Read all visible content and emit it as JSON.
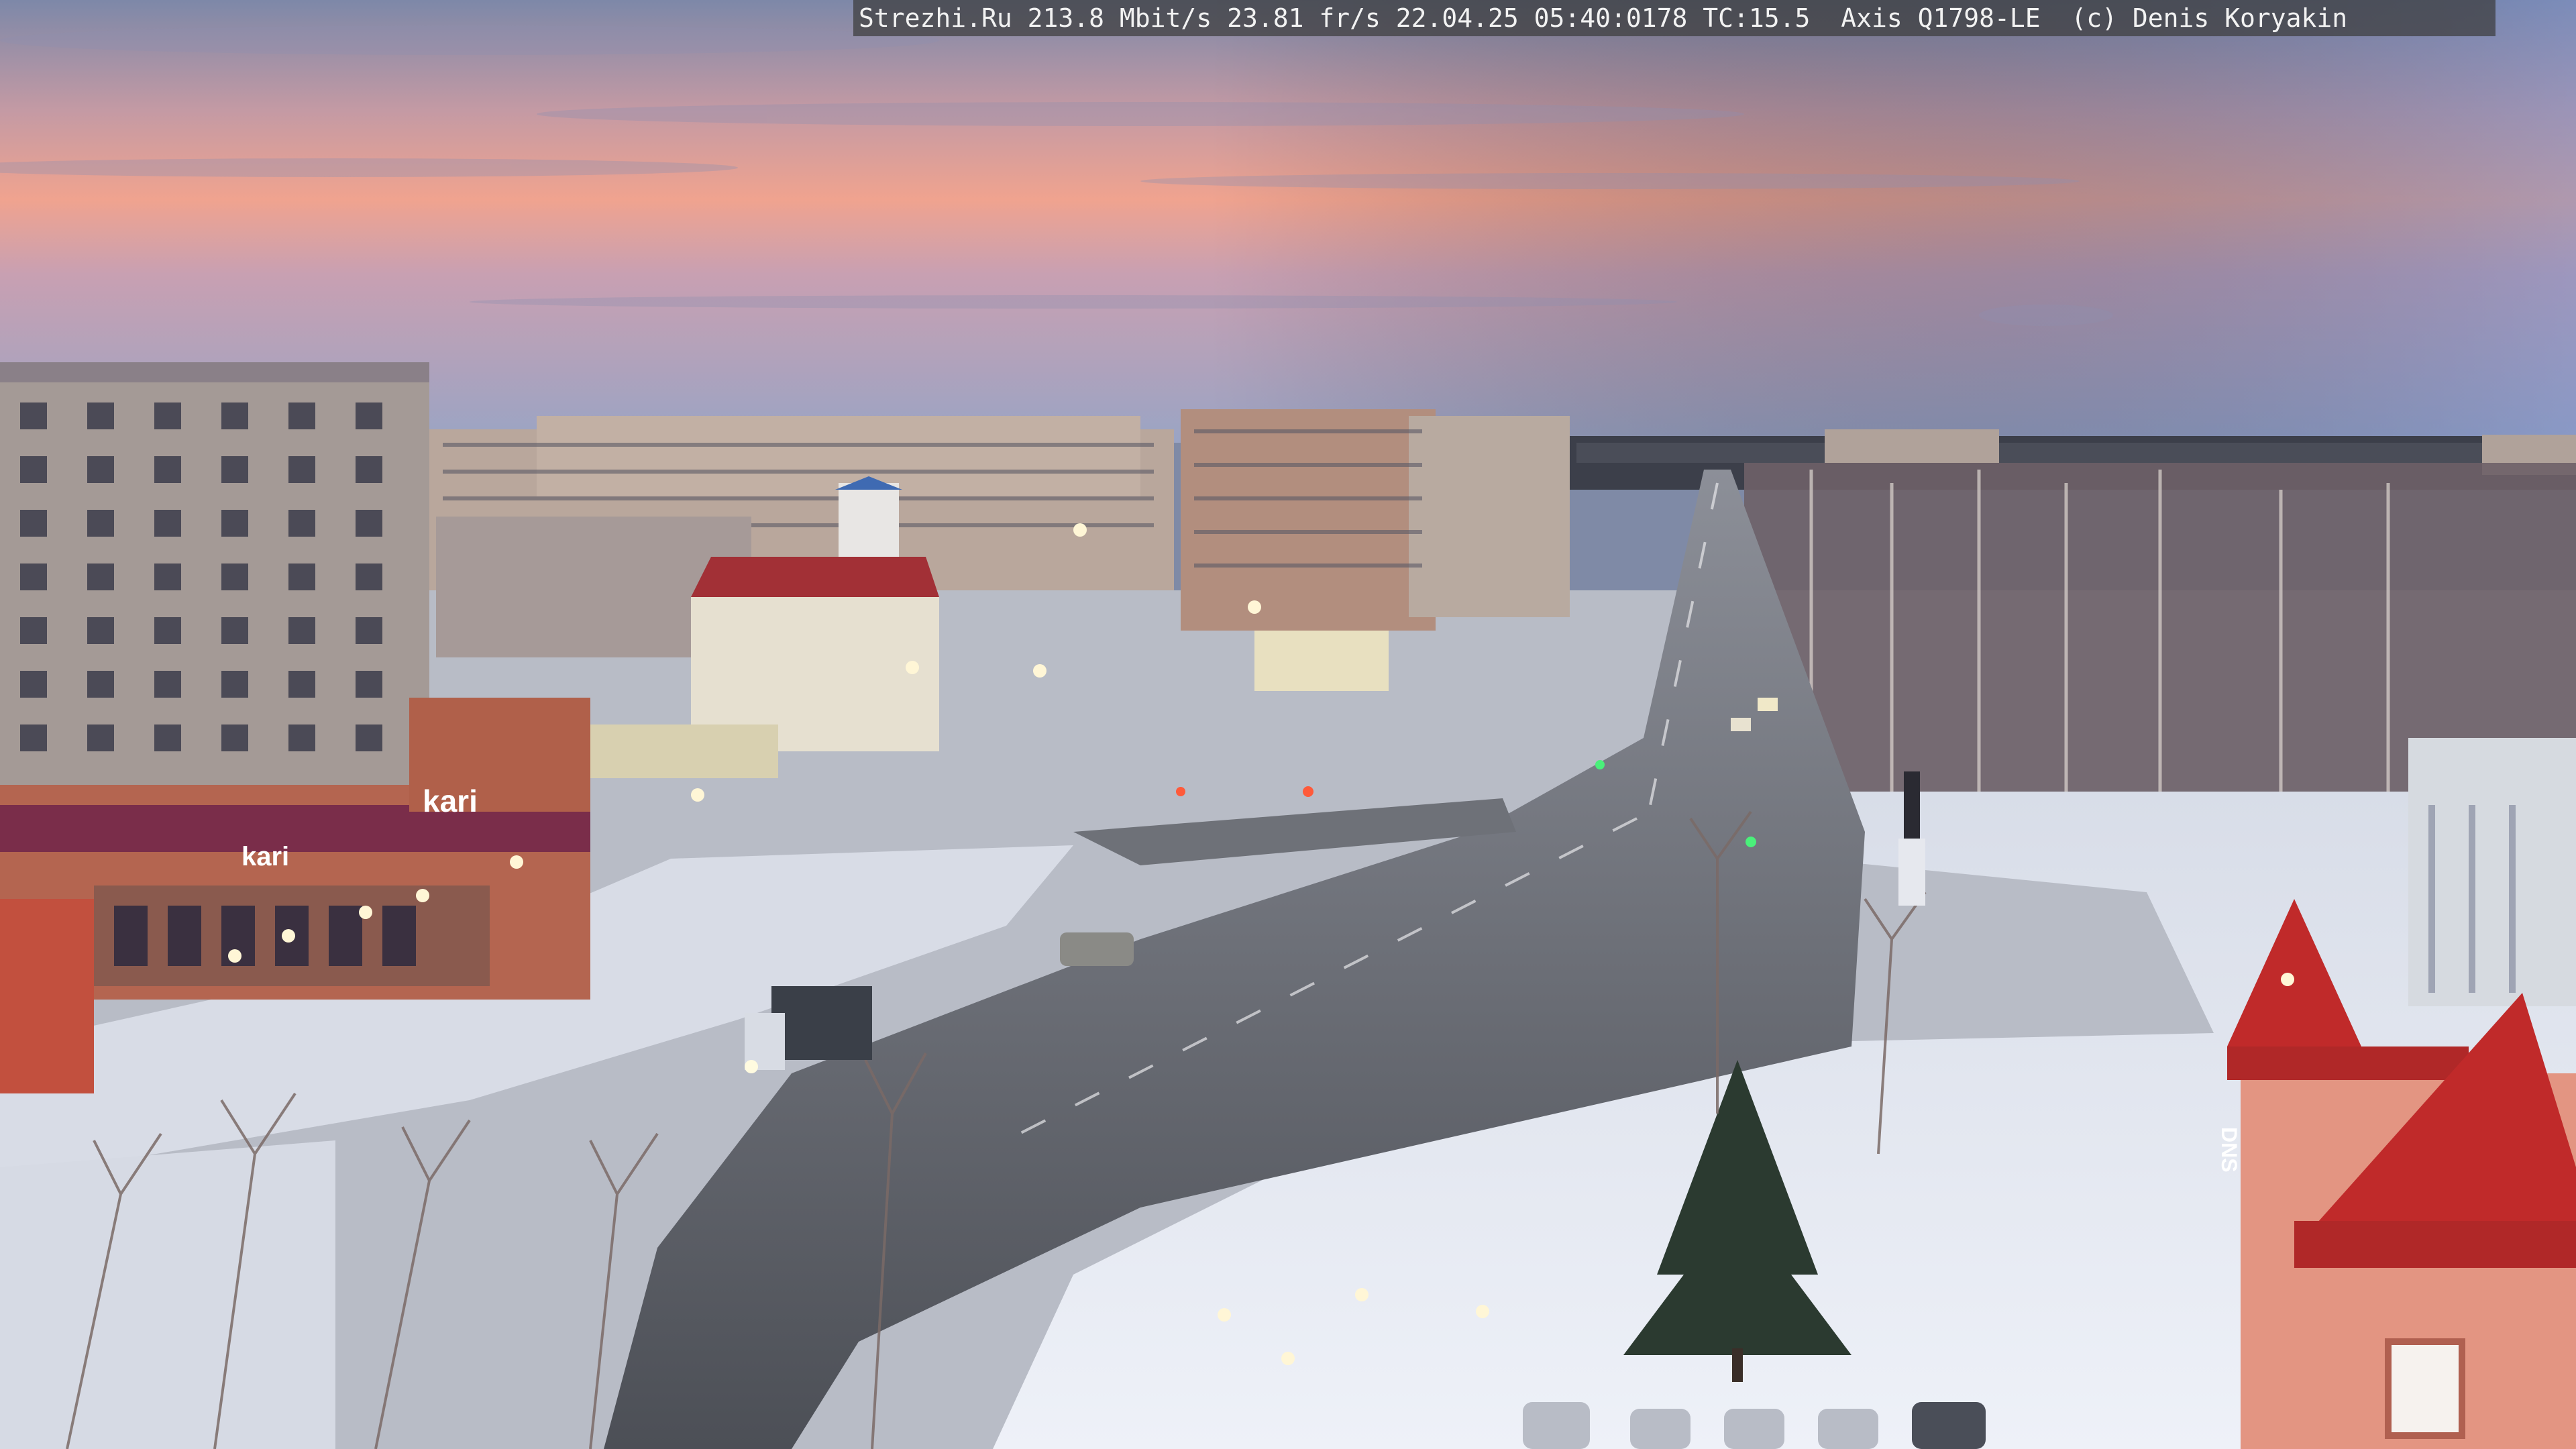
{
  "overlay": {
    "text": "Strezhi.Ru 213.8 Mbit/s 23.81 fr/s 22.04.25 05:40:0178 TC:15.5  Axis Q1798-LE  (c) Denis Koryakin"
  },
  "signs": {
    "store_sign": "kari",
    "pharmacy": "DNS"
  },
  "colors": {
    "sky_top": "#8a96b8",
    "sky_glow": "#f0a08c",
    "snow": "#e8ecf4",
    "road": "#5e6168",
    "roof_red": "#c02a2a"
  }
}
